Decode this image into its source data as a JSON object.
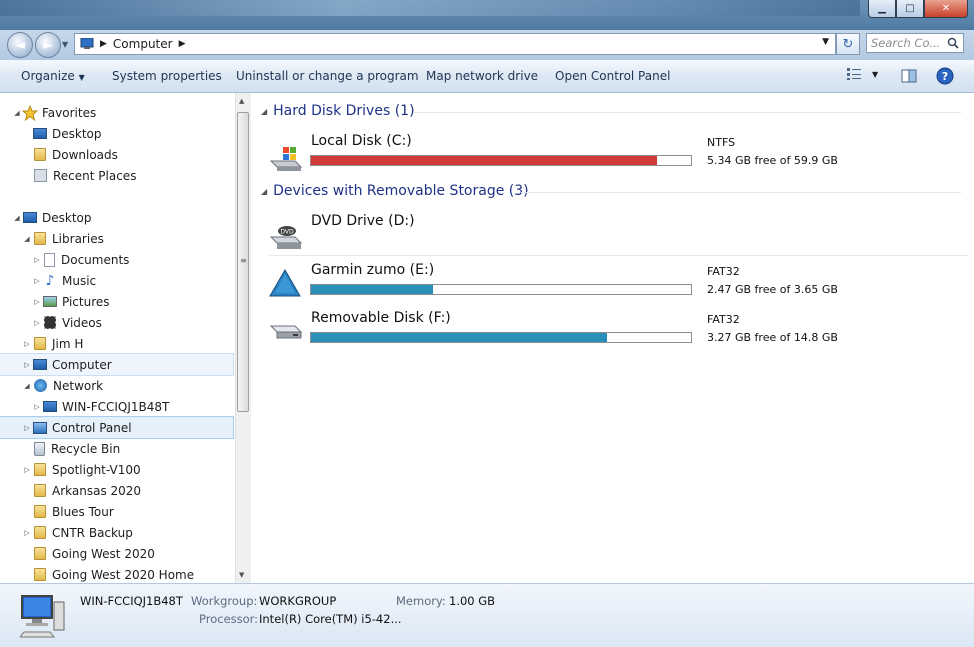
{
  "window": {
    "title": "Computer"
  },
  "address": {
    "breadcrumb": "Computer",
    "search_placeholder": "Search Co..."
  },
  "toolbar": {
    "organize": "Organize",
    "system_properties": "System properties",
    "uninstall": "Uninstall or change a program",
    "map_drive": "Map network drive",
    "control_panel": "Open Control Panel"
  },
  "nav": {
    "favorites": {
      "label": "Favorites",
      "items": [
        "Desktop",
        "Downloads",
        "Recent Places"
      ]
    },
    "desktop": "Desktop",
    "libraries": {
      "label": "Libraries",
      "items": [
        "Documents",
        "Music",
        "Pictures",
        "Videos"
      ]
    },
    "user": "Jim H",
    "computer": "Computer",
    "network": "Network",
    "network_pc": "WIN-FCCIQJ1B48T",
    "control_panel": "Control Panel",
    "recycle": "Recycle Bin",
    "folders": [
      "Spotlight-V100",
      "Arkansas 2020",
      "Blues Tour",
      "CNTR Backup",
      "Going West 2020",
      "Going West 2020 Home"
    ]
  },
  "groups": {
    "hdd": "Hard Disk Drives (1)",
    "removable": "Devices with Removable Storage (3)"
  },
  "drives": {
    "c": {
      "name": "Local Disk (C:)",
      "fs": "NTFS",
      "free": "5.34 GB free of 59.9 GB",
      "used_fraction": 0.91,
      "color": "#d23a3a"
    },
    "d": {
      "name": "DVD Drive (D:)"
    },
    "e": {
      "name": "Garmin zumo (E:)",
      "fs": "FAT32",
      "free": "2.47 GB free of 3.65 GB",
      "used_fraction": 0.32,
      "color": "#2a8fb8"
    },
    "f": {
      "name": "Removable Disk (F:)",
      "fs": "FAT32",
      "free": "3.27 GB free of 14.8 GB",
      "used_fraction": 0.78,
      "color": "#2a8fb8"
    }
  },
  "details": {
    "computer_name": "WIN-FCCIQJ1B48T",
    "workgroup_label": "Workgroup:",
    "workgroup": "WORKGROUP",
    "memory_label": "Memory:",
    "memory": "1.00 GB",
    "processor_label": "Processor:",
    "processor": "Intel(R) Core(TM) i5-42..."
  },
  "icons": {
    "favorites": "star-icon",
    "folder": "folder-icon",
    "computer": "computer-icon",
    "network": "network-icon",
    "drive": "hard-drive-icon",
    "dvd": "dvd-drive-icon",
    "garmin": "triangle-device-icon"
  }
}
